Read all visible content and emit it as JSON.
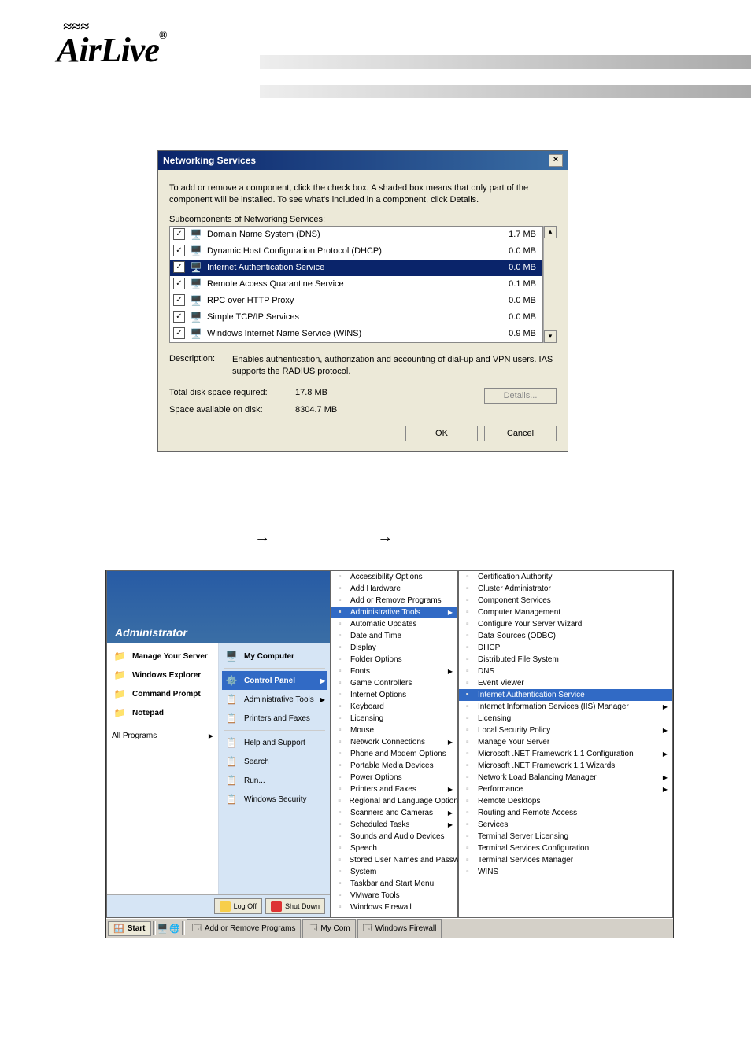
{
  "logo": {
    "name": "AirLive",
    "reg": "®"
  },
  "dialog": {
    "title": "Networking Services",
    "intro": "To add or remove a component, click the check box. A shaded box means that only part of the component will be installed. To see what's included in a component, click Details.",
    "sub_label": "Subcomponents of Networking Services:",
    "items": [
      {
        "label": "Domain Name System (DNS)",
        "size": "1.7 MB",
        "checked": "✓"
      },
      {
        "label": "Dynamic Host Configuration Protocol (DHCP)",
        "size": "0.0 MB",
        "checked": "✓"
      },
      {
        "label": "Internet Authentication Service",
        "size": "0.0 MB",
        "checked": "✓",
        "selected": true
      },
      {
        "label": "Remote Access Quarantine Service",
        "size": "0.1 MB",
        "checked": "✓"
      },
      {
        "label": "RPC over HTTP Proxy",
        "size": "0.0 MB",
        "checked": "✓"
      },
      {
        "label": "Simple TCP/IP Services",
        "size": "0.0 MB",
        "checked": "✓"
      },
      {
        "label": "Windows Internet Name Service (WINS)",
        "size": "0.9 MB",
        "checked": "✓"
      }
    ],
    "desc_label": "Description:",
    "desc_value": "Enables authentication, authorization and accounting of dial-up and VPN users. IAS supports the RADIUS protocol.",
    "total_label": "Total disk space required:",
    "total_value": "17.8 MB",
    "avail_label": "Space available on disk:",
    "avail_value": "8304.7 MB",
    "details_btn": "Details...",
    "ok_btn": "OK",
    "cancel_btn": "Cancel"
  },
  "arrow_glyph": "→",
  "start_menu": {
    "user": "Administrator",
    "left_items": [
      {
        "label": "Manage Your Server"
      },
      {
        "label": "Windows Explorer"
      },
      {
        "label": "Command Prompt"
      },
      {
        "label": "Notepad"
      }
    ],
    "right_items": [
      {
        "label": "My Computer",
        "bold": true
      },
      {
        "label": "Control Panel",
        "bold": true,
        "selected": true,
        "arrow": true
      },
      {
        "label": "Administrative Tools",
        "arrow": true
      },
      {
        "label": "Printers and Faxes"
      },
      {
        "label": "Help and Support"
      },
      {
        "label": "Search"
      },
      {
        "label": "Run..."
      },
      {
        "label": "Windows Security"
      }
    ],
    "all_programs": "All Programs",
    "logoff": "Log Off",
    "shutdown": "Shut Down",
    "control_panel_items": [
      "Accessibility Options",
      "Add Hardware",
      "Add or Remove Programs",
      "Administrative Tools",
      "Automatic Updates",
      "Date and Time",
      "Display",
      "Folder Options",
      "Fonts",
      "Game Controllers",
      "Internet Options",
      "Keyboard",
      "Licensing",
      "Mouse",
      "Network Connections",
      "Phone and Modem Options",
      "Portable Media Devices",
      "Power Options",
      "Printers and Faxes",
      "Regional and Language Options",
      "Scanners and Cameras",
      "Scheduled Tasks",
      "Sounds and Audio Devices",
      "Speech",
      "Stored User Names and Passwords",
      "System",
      "Taskbar and Start Menu",
      "VMware Tools",
      "Windows Firewall"
    ],
    "control_panel_selected": "Administrative Tools",
    "admin_tools_items": [
      "Certification Authority",
      "Cluster Administrator",
      "Component Services",
      "Computer Management",
      "Configure Your Server Wizard",
      "Data Sources (ODBC)",
      "DHCP",
      "Distributed File System",
      "DNS",
      "Event Viewer",
      "Internet Authentication Service",
      "Internet Information Services (IIS) Manager",
      "Licensing",
      "Local Security Policy",
      "Manage Your Server",
      "Microsoft .NET Framework 1.1 Configuration",
      "Microsoft .NET Framework 1.1 Wizards",
      "Network Load Balancing Manager",
      "Performance",
      "Remote Desktops",
      "Routing and Remote Access",
      "Services",
      "Terminal Server Licensing",
      "Terminal Services Configuration",
      "Terminal Services Manager",
      "WINS"
    ],
    "admin_tools_selected": "Internet Authentication Service",
    "admin_tools_with_arrow": [
      "Microsoft .NET Framework 1.1 Configuration",
      "Network Load Balancing Manager",
      "Performance",
      "Local Security Policy",
      "Internet Information Services (IIS) Manager"
    ],
    "taskbar": {
      "start": "Start",
      "items": [
        "Add or Remove Programs",
        "My Com",
        "Windows Firewall"
      ]
    }
  }
}
